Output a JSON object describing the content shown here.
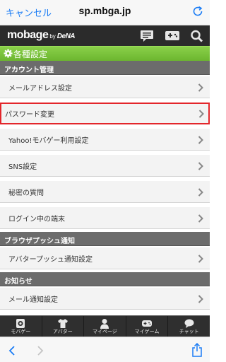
{
  "browser": {
    "cancel_label": "キャンセル",
    "url": "sp.mbga.jp"
  },
  "header": {
    "logo_text": "mobage",
    "logo_by": "by",
    "logo_company": "DeNA"
  },
  "page": {
    "title": "各種設定"
  },
  "sections": [
    {
      "title": "アカウント管理",
      "items": [
        "メールアドレス設定",
        "パスワード変更",
        "Yahoo!モバゲー利用設定",
        "SNS設定",
        "秘密の質問",
        "ログイン中の端末"
      ]
    },
    {
      "title": "ブラウザプッシュ通知",
      "items": [
        "アバタープッシュ通知設定"
      ]
    },
    {
      "title": "お知らせ",
      "items": [
        "メール通知設定"
      ]
    }
  ],
  "tabbar": {
    "items": [
      "モバゲー",
      "アバター",
      "マイページ",
      "マイゲーム",
      "チャット"
    ]
  },
  "colors": {
    "accent_green": "#7cc23d",
    "highlight_red": "#e3262b",
    "link_blue": "#1a7cf5"
  }
}
